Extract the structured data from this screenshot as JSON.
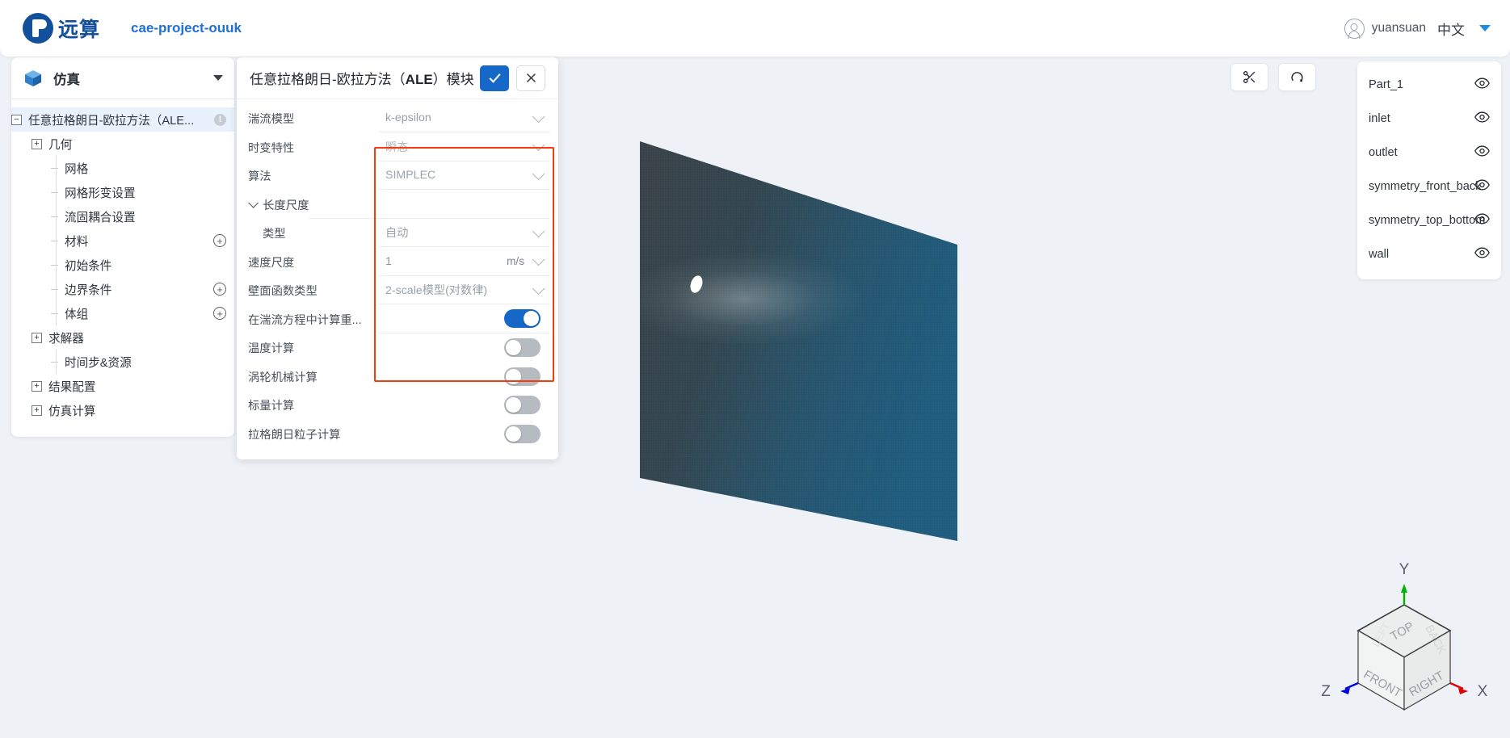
{
  "header": {
    "logo_text": "远算",
    "project_name": "cae-project-ouuk",
    "username": "yuansuan",
    "language": "中文"
  },
  "sidebar": {
    "title": "仿真",
    "tree": [
      {
        "label": "任意拉格朗日-欧拉方法（ALE...",
        "toggle": "minus",
        "level": 0,
        "selected": true,
        "badge": "info"
      },
      {
        "label": "几何",
        "toggle": "plus",
        "level": 1
      },
      {
        "label": "网格",
        "toggle": "dash",
        "level": 2
      },
      {
        "label": "网格形变设置",
        "toggle": "dash",
        "level": 2
      },
      {
        "label": "流固耦合设置",
        "toggle": "dash",
        "level": 2
      },
      {
        "label": "材料",
        "toggle": "dash",
        "level": 2,
        "badge": "plus"
      },
      {
        "label": "初始条件",
        "toggle": "dash",
        "level": 2
      },
      {
        "label": "边界条件",
        "toggle": "dash",
        "level": 2,
        "badge": "plus"
      },
      {
        "label": "体组",
        "toggle": "dash",
        "level": 2,
        "badge": "plus"
      },
      {
        "label": "求解器",
        "toggle": "plus",
        "level": 1
      },
      {
        "label": "时间步&资源",
        "toggle": "dash",
        "level": 2
      },
      {
        "label": "结果配置",
        "toggle": "plus",
        "level": 1
      },
      {
        "label": "仿真计算",
        "toggle": "plus",
        "level": 1
      }
    ]
  },
  "dialog": {
    "title_prefix": "任意拉格朗日-欧拉方法（",
    "title_bold": "ALE",
    "title_suffix": "）模块",
    "confirm_label": "✓",
    "cancel_label": "✕",
    "rows": [
      {
        "kind": "select",
        "label": "湍流模型",
        "value": "k-epsilon"
      },
      {
        "kind": "select",
        "label": "时变特性",
        "value": "瞬态",
        "dim": true
      },
      {
        "kind": "select",
        "label": "算法",
        "value": "SIMPLEC"
      },
      {
        "kind": "group",
        "label": "长度尺度"
      },
      {
        "kind": "select",
        "label": "类型",
        "value": "自动",
        "indent": true
      },
      {
        "kind": "input",
        "label": "速度尺度",
        "value": "1",
        "unit": "m/s"
      },
      {
        "kind": "select",
        "label": "壁面函数类型",
        "value": "2-scale模型(对数律)"
      },
      {
        "kind": "toggle",
        "label": "在湍流方程中计算重...",
        "on": true
      },
      {
        "kind": "toggle",
        "label": "温度计算",
        "on": false
      },
      {
        "kind": "toggle",
        "label": "涡轮机械计算",
        "on": false
      },
      {
        "kind": "toggle",
        "label": "标量计算",
        "on": false
      },
      {
        "kind": "toggle",
        "label": "拉格朗日粒子计算",
        "on": false
      }
    ],
    "highlight_color": "#f63b0d"
  },
  "viewport": {
    "tools": [
      {
        "name": "scissors-icon"
      },
      {
        "name": "rotate-icon"
      }
    ],
    "parts": [
      {
        "name": "Part_1"
      },
      {
        "name": "inlet"
      },
      {
        "name": "outlet"
      },
      {
        "name": "symmetry_front_back"
      },
      {
        "name": "symmetry_top_bottom"
      },
      {
        "name": "wall"
      }
    ],
    "axis": {
      "x": "X",
      "y": "Y",
      "z": "Z",
      "faces": [
        "TOP",
        "FRONT",
        "RIGHT",
        "BACK",
        "LEFT"
      ]
    },
    "model_color": "#2f5f7f",
    "background_color": "#eef1f6"
  }
}
